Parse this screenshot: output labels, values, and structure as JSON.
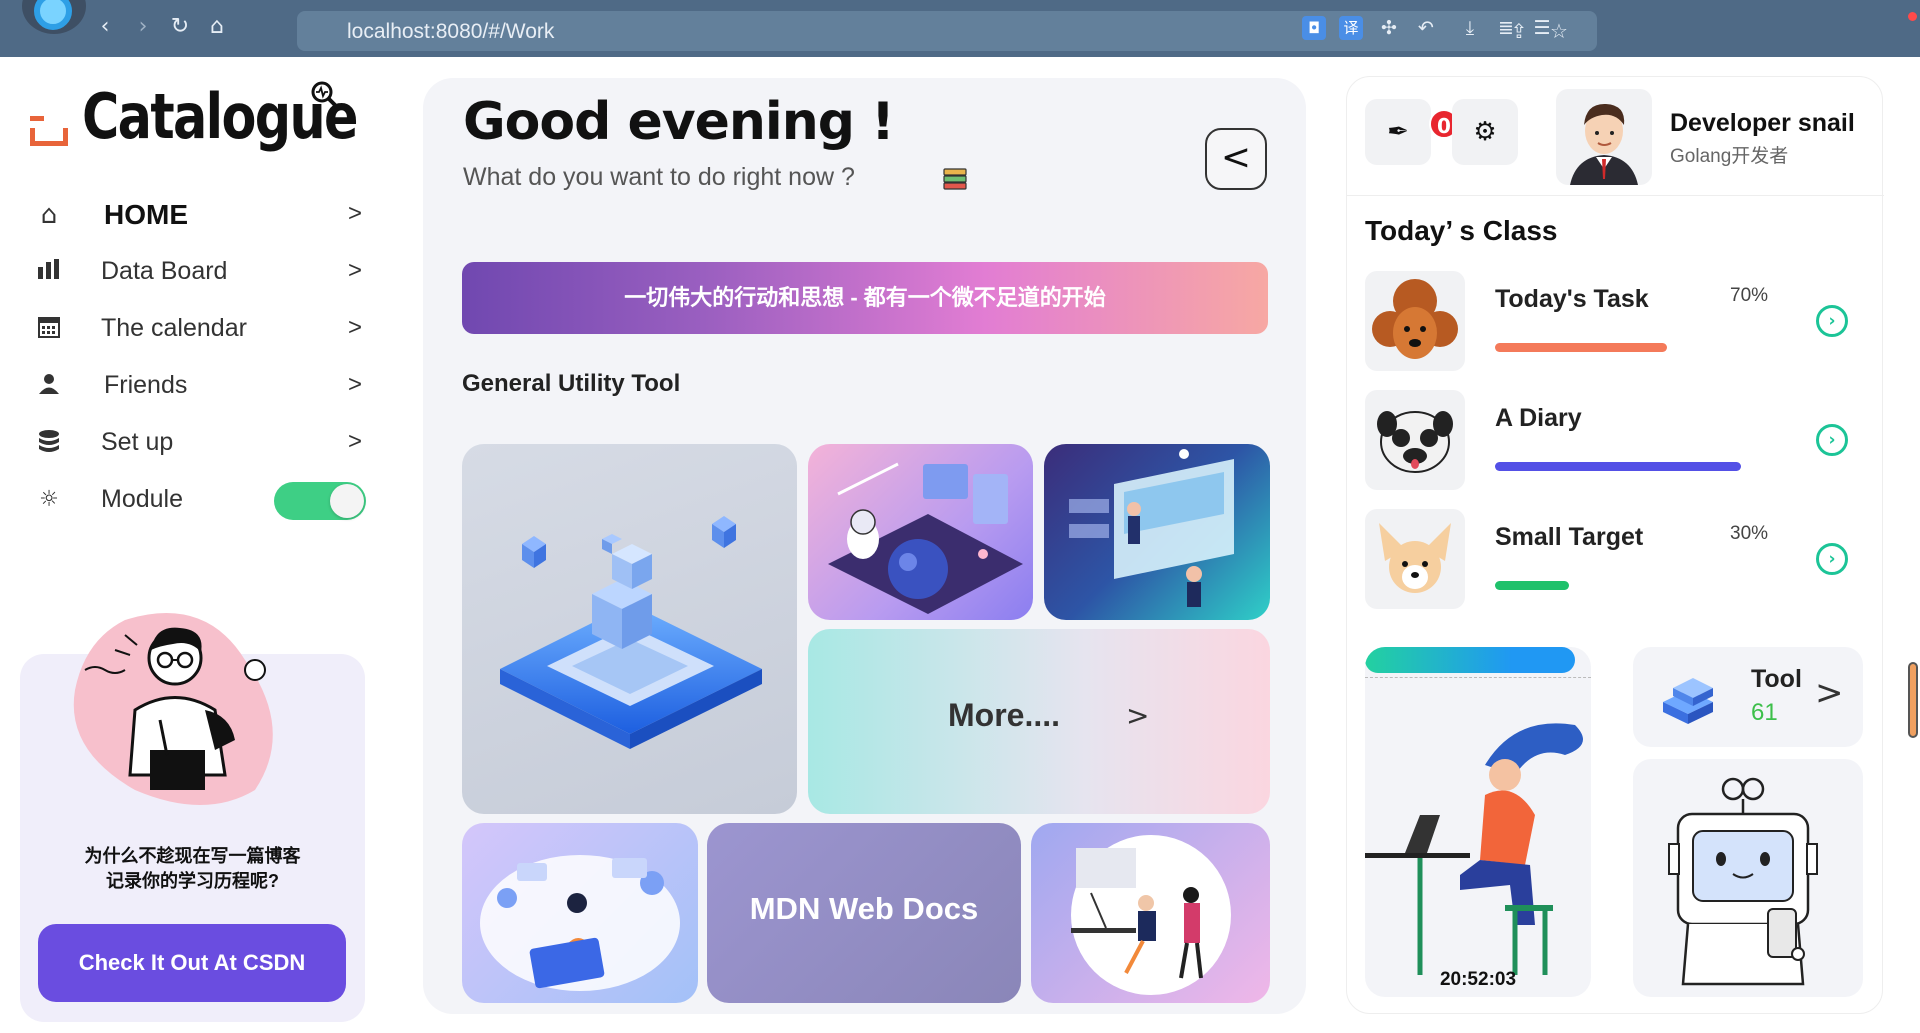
{
  "browser": {
    "url": "localhost:8080/#/Work",
    "translate_label": "译"
  },
  "brand": {
    "name": "Catalogue"
  },
  "menu": [
    {
      "label": "HOME",
      "arrow": ">"
    },
    {
      "label": "Data Board",
      "arrow": ">"
    },
    {
      "label": "The calendar",
      "arrow": ">"
    },
    {
      "label": "Friends",
      "arrow": ">"
    },
    {
      "label": "Set up",
      "arrow": ">"
    },
    {
      "label": "Module",
      "toggle_on": true
    }
  ],
  "promo": {
    "line1": "为什么不趁现在写一篇博客",
    "line2": "记录你的学习历程呢?",
    "button": "Check It Out At CSDN"
  },
  "main": {
    "greeting": "Good evening !",
    "subtitle": "What do you want to do right now ?",
    "back_label": "<",
    "quote": "一切伟大的行动和思想 - 都有一个微不足道的开始",
    "section_title": "General Utility Tool",
    "more_label": "More....",
    "more_arrow": ">",
    "mdn_label": "MDN Web Docs"
  },
  "right": {
    "badge_count": "0",
    "user_name": "Developer snail",
    "user_role": "Golang开发者",
    "title": "Today’ s Class",
    "tasks": [
      {
        "name": "Today's Task",
        "percent": "70%",
        "progress": 0.7,
        "color": "#f47a5a"
      },
      {
        "name": "A Diary",
        "percent": "",
        "progress": 1.0,
        "color": "#5350e6"
      },
      {
        "name": "Small Target",
        "percent": "30%",
        "progress": 0.3,
        "color": "#1fc16b"
      }
    ],
    "clock": "20:52:03",
    "tool": {
      "name": "Tool",
      "count": "61",
      "arrow": ">"
    }
  },
  "colors": {
    "accent": "#6a4de0",
    "toggle": "#3ecf85",
    "badge": "#e8262f",
    "check": "#1cc497"
  }
}
